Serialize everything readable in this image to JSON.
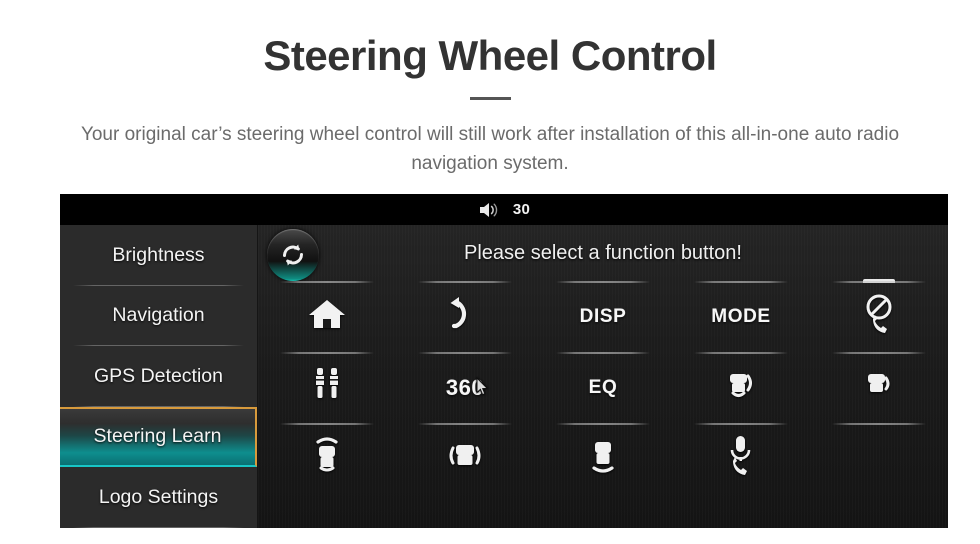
{
  "header": {
    "title": "Steering Wheel Control",
    "subtitle": "Your original car’s steering wheel control will still work after installation of this all-in-one auto radio navigation system."
  },
  "device": {
    "statusbar": {
      "volume_icon": "speaker-icon",
      "volume_value": "30"
    },
    "sidebar": {
      "items": [
        {
          "label": "Brightness",
          "selected": false
        },
        {
          "label": "Navigation",
          "selected": false
        },
        {
          "label": "GPS Detection",
          "selected": false
        },
        {
          "label": "Steering Learn",
          "selected": true
        },
        {
          "label": "Logo Settings",
          "selected": false
        }
      ]
    },
    "main": {
      "prompt": "Please select a function button!",
      "sync_button_icon": "refresh-sync-icon",
      "cursor_icon": "mouse-cursor",
      "partial_top_icon": "car-top-partial-icon",
      "grid": [
        {
          "type": "icon",
          "name": "home-icon",
          "label": ""
        },
        {
          "type": "icon",
          "name": "back-arrow-icon",
          "label": ""
        },
        {
          "type": "text",
          "name": "disp-button",
          "label": "DISP"
        },
        {
          "type": "text",
          "name": "mode-button",
          "label": "MODE"
        },
        {
          "type": "icon",
          "name": "call-mute-icon",
          "label": ""
        },
        {
          "type": "icon",
          "name": "aux-jack-icon",
          "label": ""
        },
        {
          "type": "text",
          "name": "view-360-button",
          "label": "360"
        },
        {
          "type": "text",
          "name": "eq-button",
          "label": "EQ"
        },
        {
          "type": "icon",
          "name": "car-volume-up-icon",
          "label": ""
        },
        {
          "type": "icon",
          "name": "car-volume-down-icon",
          "label": ""
        },
        {
          "type": "icon",
          "name": "car-front-wave-icon",
          "label": ""
        },
        {
          "type": "icon",
          "name": "car-side-wave-icon",
          "label": ""
        },
        {
          "type": "icon",
          "name": "car-rear-wave-icon",
          "label": ""
        },
        {
          "type": "icon",
          "name": "voice-call-mic-icon",
          "label": ""
        },
        {
          "type": "empty",
          "name": "empty-cell",
          "label": ""
        }
      ]
    }
  },
  "colors": {
    "title": "#333333",
    "subtitle": "#6b6b6b",
    "panel_bg": "#0a0a0a",
    "sidebar_bg": "#2b2b2b",
    "accent_teal": "#16c4b4",
    "accent_gold": "#d79a3c"
  }
}
